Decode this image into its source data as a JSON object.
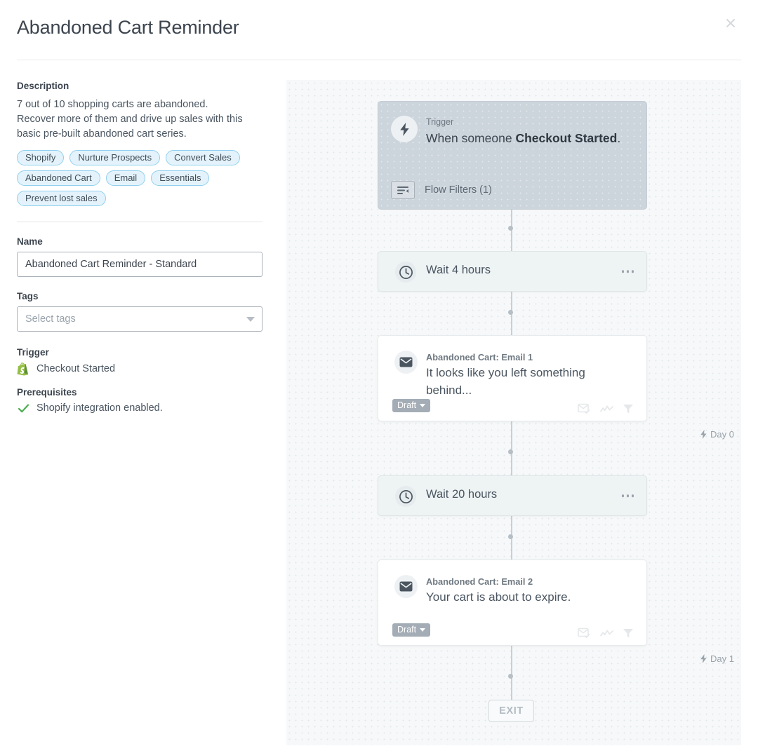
{
  "header": {
    "title": "Abandoned Cart Reminder",
    "close_label": "×"
  },
  "sidebar": {
    "description_label": "Description",
    "description_text": "7 out of 10 shopping carts are abandoned. Recover more of them and drive up sales with this basic pre-built abandoned cart series.",
    "tags": [
      "Shopify",
      "Nurture Prospects",
      "Convert Sales",
      "Abandoned Cart",
      "Email",
      "Essentials",
      "Prevent lost sales"
    ],
    "name_label": "Name",
    "name_value": "Abandoned Cart Reminder - Standard",
    "tags_label": "Tags",
    "tags_placeholder": "Select tags",
    "trigger_label": "Trigger",
    "trigger_value": "Checkout Started",
    "prerequisites_label": "Prerequisites",
    "prerequisites_value": "Shopify integration enabled."
  },
  "flow": {
    "trigger": {
      "kicker": "Trigger",
      "sentence_prefix": "When someone ",
      "sentence_bold": "Checkout Started",
      "sentence_suffix": ".",
      "filters_label": "Flow Filters (1)"
    },
    "wait1": {
      "label": "Wait 4 hours"
    },
    "email1": {
      "subtitle": "Abandoned Cart: Email 1",
      "title": "It looks like you left something behind...",
      "status": "Draft",
      "day_label": "Day 0"
    },
    "wait2": {
      "label": "Wait 20 hours"
    },
    "email2": {
      "subtitle": "Abandoned Cart: Email 2",
      "title": "Your cart is about to expire.",
      "status": "Draft",
      "day_label": "Day 1"
    },
    "exit": {
      "label": "EXIT"
    }
  },
  "colors": {
    "accent_tag_border": "#8fd0ee",
    "accent_tag_bg": "#e4f3fb",
    "trigger_node_bg": "#ccd4dc",
    "wait_node_bg": "#eef3f4",
    "canvas_bg": "#f6f8f9",
    "shopify_green": "#95bf47",
    "check_green": "#4caf50",
    "draft_badge_bg": "#a4adb6"
  }
}
